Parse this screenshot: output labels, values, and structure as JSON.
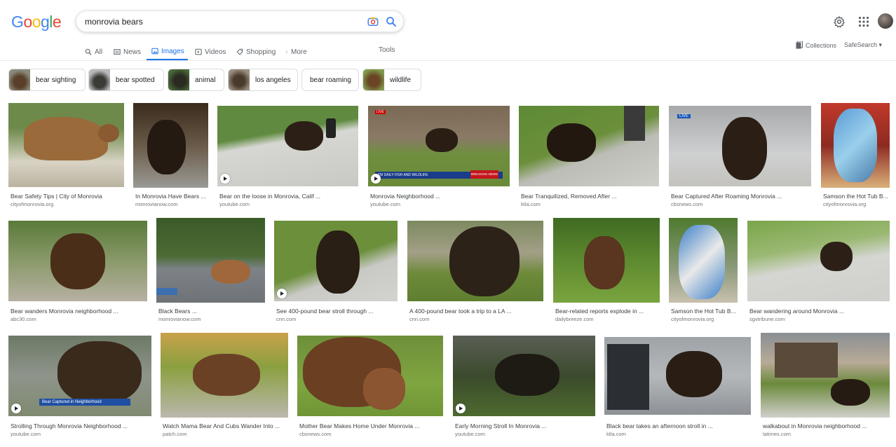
{
  "header": {
    "logo": [
      "G",
      "o",
      "o",
      "g",
      "l",
      "e"
    ],
    "logo_colors": [
      "#4285F4",
      "#EA4335",
      "#FBBC05",
      "#4285F4",
      "#34A853",
      "#EA4335"
    ],
    "query": "monrovia bears"
  },
  "tabs": {
    "all": "All",
    "news": "News",
    "images": "Images",
    "videos": "Videos",
    "shopping": "Shopping",
    "more": "More",
    "tools": "Tools",
    "collections": "Collections",
    "safesearch": "SafeSearch ▾"
  },
  "chips": [
    {
      "label": "bear sighting"
    },
    {
      "label": "bear spotted"
    },
    {
      "label": "animal"
    },
    {
      "label": "los angeles"
    },
    {
      "label": "bear roaming"
    },
    {
      "label": "wildlife"
    }
  ],
  "results": [
    {
      "title": "Bear Safety Tips | City of Monrovia",
      "source": "cityofmonrovia.org"
    },
    {
      "title": "In Monrovia Have Bears ...",
      "source": "monrovianow.com"
    },
    {
      "title": "Bear on the loose in Monrovia, Calif ...",
      "source": "youtube.com"
    },
    {
      "title": "Monrovia Neighborhood ...",
      "source": "youtube.com"
    },
    {
      "title": "Bear Tranquilized, Removed After ...",
      "source": "ktla.com"
    },
    {
      "title": "Bear Captured After Roaming Monrovia ...",
      "source": "cbsnews.com"
    },
    {
      "title": "Samson the Hot Tub B...",
      "source": "cityofmonrovia.org"
    },
    {
      "title": "Bear wanders Monrovia neighborhood ...",
      "source": "abc30.com"
    },
    {
      "title": "Black Bears ...",
      "source": "monrovianow.com"
    },
    {
      "title": "See 400-pound bear stroll through ...",
      "source": "cnn.com"
    },
    {
      "title": "A 400-pound bear took a trip to a LA ...",
      "source": "cnn.com"
    },
    {
      "title": "Bear-related reports explode in ...",
      "source": "dailybreeze.com"
    },
    {
      "title": "Samson the Hot Tub B...",
      "source": "cityofmonrovia.org"
    },
    {
      "title": "Bear wandering around Monrovia ...",
      "source": "sgvtribune.com"
    },
    {
      "title": "Strolling Through Monrovia Neighborhood ...",
      "source": "youtube.com"
    },
    {
      "title": "Watch Mama Bear And Cubs Wander Into ...",
      "source": "patch.com"
    },
    {
      "title": "Mother Bear Makes Home Under Monrovia ...",
      "source": "cbsnews.com"
    },
    {
      "title": "Early Morning Stroll In Monrovia ...",
      "source": "youtube.com"
    },
    {
      "title": "Black bear takes an afternoon stroll in ...",
      "source": "ktla.com"
    },
    {
      "title": "walkabout in Monrovia neighborhood ...",
      "source": "latimes.com"
    }
  ],
  "overlays": {
    "live1": "LIVE",
    "breaking": "BREAKING NEWS",
    "tmdaily": "TM DAILY  FISH AND WILDLIFE",
    "live2": "LIVE",
    "captured": "Bear Captured in Neighborhood"
  }
}
